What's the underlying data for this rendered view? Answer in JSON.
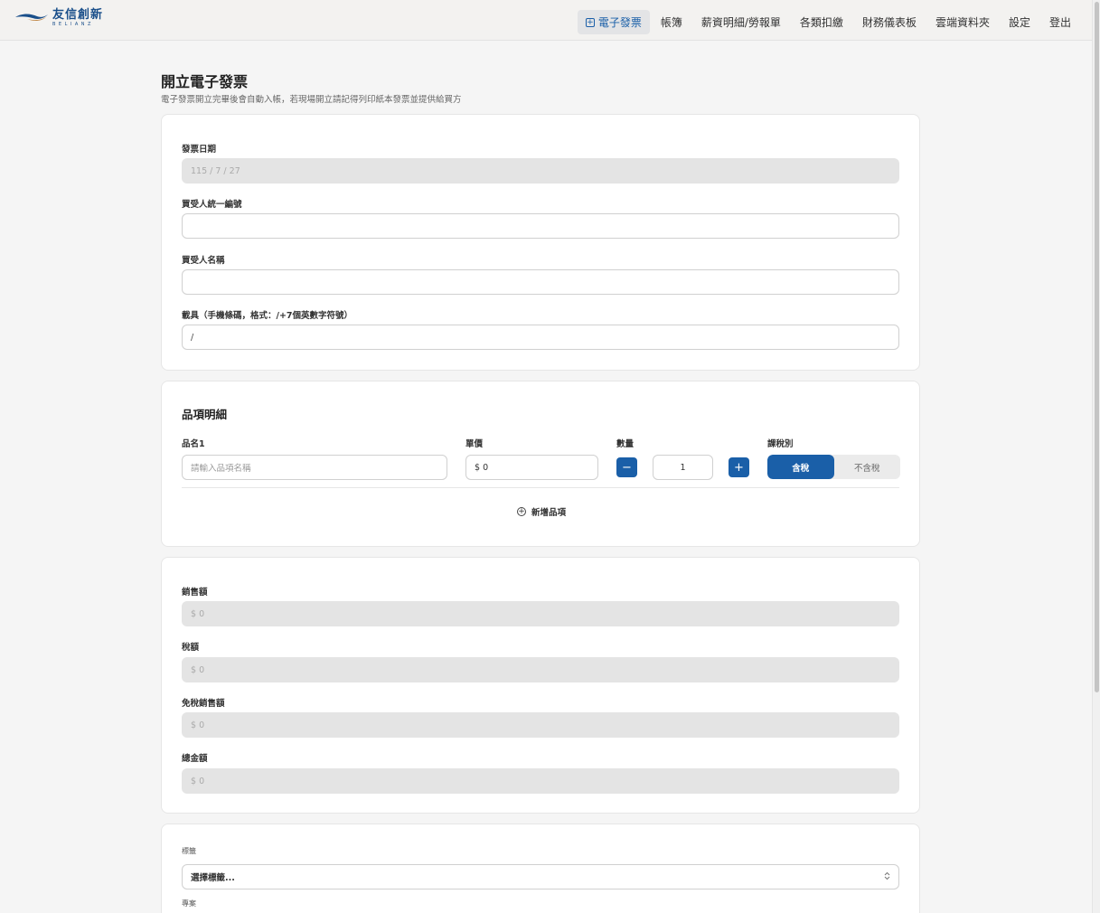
{
  "nav": {
    "logo_main": "友信創新",
    "logo_sub": "BELIANZ",
    "items": [
      {
        "label": "電子發票"
      },
      {
        "label": "帳簿"
      },
      {
        "label": "薪資明細/勞報單"
      },
      {
        "label": "各類扣繳"
      },
      {
        "label": "財務儀表板"
      },
      {
        "label": "雲端資料夾"
      },
      {
        "label": "設定"
      },
      {
        "label": "登出"
      }
    ]
  },
  "page": {
    "title": "開立電子發票",
    "subtitle": "電子發票開立完畢後會自動入帳，若現場開立請記得列印紙本發票並提供給買方"
  },
  "invoice_form": {
    "date_label": "發票日期",
    "date_value": "115 / 7 / 27",
    "buyer_id_label": "買受人統一編號",
    "buyer_id_value": "",
    "buyer_name_label": "買受人名稱",
    "buyer_name_value": "",
    "carrier_label": "載具（手機條碼，格式：/+7個英數字符號）",
    "carrier_value": "/"
  },
  "items": {
    "title": "品項明細",
    "name_label": "品名1",
    "name_placeholder": "請輸入品項名稱",
    "price_label": "單價",
    "price_value": "$ 0",
    "qty_label": "數量",
    "qty_value": "1",
    "minus": "−",
    "plus": "+",
    "tax_label": "課稅別",
    "tax_options": [
      "含稅",
      "不含稅"
    ],
    "tax_selected": "含稅",
    "add_icon": "⊕",
    "add_label": "新增品項"
  },
  "totals": {
    "sales_label": "銷售額",
    "sales_value": "$ 0",
    "tax_label": "稅額",
    "tax_value": "$ 0",
    "exempt_label": "免稅銷售額",
    "exempt_value": "$ 0",
    "total_label": "總金額",
    "total_value": "$ 0"
  },
  "tags": {
    "tag_label": "標籤",
    "tag_placeholder": "選擇標籤...",
    "project_label": "專案",
    "caret": "⌃⌄"
  },
  "colors": {
    "accent": "#1a5fa8",
    "background": "#f5f5f5",
    "disabled": "#e4e4e4"
  }
}
